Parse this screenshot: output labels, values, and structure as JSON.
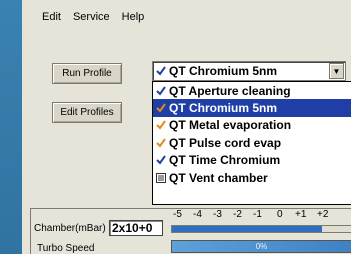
{
  "menu": [
    "Edit",
    "Service",
    "Help"
  ],
  "buttons": {
    "run_profile": "Run Profile",
    "edit_profiles": "Edit Profiles"
  },
  "profile_select": {
    "value": "QT Chromium 5nm"
  },
  "dropdown": {
    "items": [
      {
        "label": "QT Aperture cleaning",
        "icon": "check-mark-icon",
        "selected": false
      },
      {
        "label": "QT Chromium 5nm",
        "icon": "check-mark-icon",
        "selected": true
      },
      {
        "label": "QT Metal evaporation",
        "icon": "check-mark-icon",
        "selected": false
      },
      {
        "label": "QT Pulse cord evap",
        "icon": "check-mark-icon",
        "selected": false
      },
      {
        "label": "QT Time Chromium",
        "icon": "check-mark-icon",
        "selected": false
      },
      {
        "label": "QT Vent chamber",
        "icon": "vent-icon",
        "selected": false
      }
    ]
  },
  "status": {
    "chamber_label": "Chamber(mBar)",
    "chamber_value": "2x10+0",
    "scale_ticks": [
      "-5",
      "-4",
      "-3",
      "-2",
      "-1",
      "0",
      "+1",
      "+2"
    ],
    "turbo_label": "Turbo Speed",
    "turbo_text": "0%"
  },
  "colors": {
    "desktop": "#4a8fbd",
    "window": "#e6e4d9",
    "selection": "#1f3fa6",
    "check_blue": "#1f3fa6",
    "check_orange": "#e08a1e"
  }
}
